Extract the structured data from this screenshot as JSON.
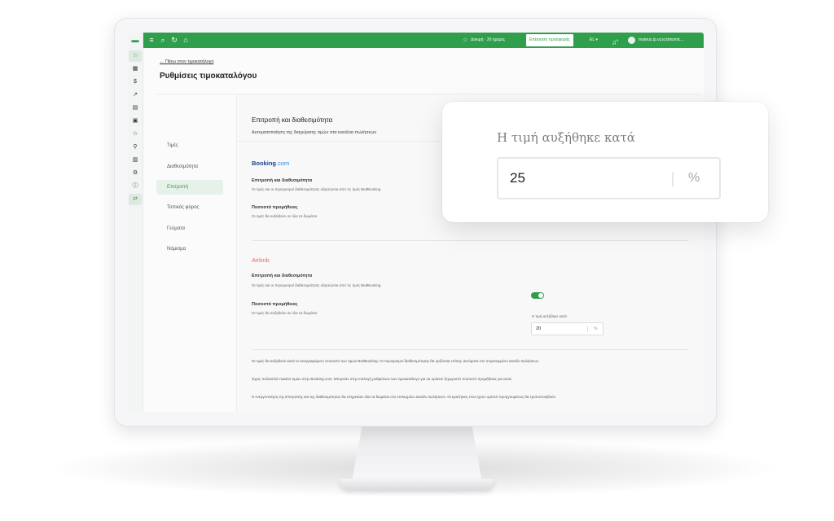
{
  "app": {
    "topbar": {
      "subscription_text": "Δοκιμή · 20 ημέρες",
      "upgrade_label": "Επέκταση προσφοράς",
      "language_label": "EL",
      "notifications_count": "9",
      "user_email": "mateus.ip.vcscstmsmic..."
    },
    "page": {
      "back_link": "Πίσω στον τιμοκατάλογο",
      "title": "Ρυθμίσεις τιμοκαταλόγου"
    },
    "tabs": [
      {
        "label": "Τιμές",
        "active": false
      },
      {
        "label": "Διαθεσιμότητα",
        "active": false
      },
      {
        "label": "Επιτροπή",
        "active": true
      },
      {
        "label": "Τοπικός φόρος",
        "active": false
      },
      {
        "label": "Γεύματα",
        "active": false
      },
      {
        "label": "Νόμισμα",
        "active": false
      }
    ],
    "section": {
      "title": "Επιτροπή και διαθεσιμότητα",
      "subtitle": "Αυτοματοποίηση της διαχείρισης τιμών στα κανάλια πωλήσεων"
    },
    "booking": {
      "brand_part1": "Booking",
      "brand_part2": ".com",
      "row1_title": "Επιτροπή και διαθεσιμότητα",
      "row1_desc": "Οι τιμές και οι περιορισμοί διαθεσιμότητας εξαρτώνται από τις τιμές BedBooking",
      "row2_title": "Ποσοστό προμήθειας",
      "row2_desc": "Οι τιμές θα αυξηθούν σε όλα τα δωμάτια"
    },
    "airbnb": {
      "brand": "Airbnb",
      "row1_title": "Επιτροπή και διαθεσιμότητα",
      "row1_desc": "Οι τιμές και οι περιορισμοί διαθεσιμότητας εξαρτώνται από τις τιμές BedBooking",
      "toggle_on": true,
      "row2_title": "Ποσοστό προμήθειας",
      "row2_desc": "Οι τιμές θα αυξηθούν σε όλα τα δωμάτια",
      "input_label": "Η τιμή αυξήθηκε κατά",
      "input_value": "20",
      "input_unit": "%"
    },
    "notes": [
      "Οι τιμές θα αυξηθούν κατά το αναγραφόμενο ποσοστό των τιμών BedBooking. Οι περιορισμοί διαθεσιμότητας θα ορίζονται επίσης αυτόματα στο συγκεκριμένο κανάλι πωλήσεων.",
      "Έχεις πολλαπλά πακέτα τιμών στην Booking.com; Μπορείτε στην επιλογή ρυθμίσεων των τιμοκατάλογο για να ορίσετε ξεχωριστό ποσοστό προμήθειας για αυτά.",
      "Η ενεργοποίηση της Επιτροπής και της διαθεσιμότητας θα επηρεάσει όλα τα δωμάτια στο επιλεγμένο κανάλι πωλήσεων. Οι κρατήσεις που έχουν ορίστεί προηγουμένως θα τροποποιηθούν."
    ],
    "callout": {
      "label": "Η τιμή αυξήθηκε κατά",
      "value": "25",
      "unit": "%"
    },
    "colors": {
      "brand_green": "#2f9f4c",
      "booking_blue": "#1d3f8f",
      "airbnb_red": "#f0665f"
    },
    "icons": {
      "rail": [
        "star-icon",
        "calendar-icon",
        "dollar-icon",
        "chart-icon",
        "document-icon",
        "grid-icon",
        "star-outline-icon",
        "user-plus-icon",
        "briefcase-icon",
        "settings-icon",
        "info-icon",
        "sync-icon"
      ],
      "topbar": [
        "menu-icon",
        "search-icon",
        "refresh-icon",
        "home-icon",
        "star-icon",
        "bell-icon",
        "avatar-icon"
      ]
    }
  }
}
